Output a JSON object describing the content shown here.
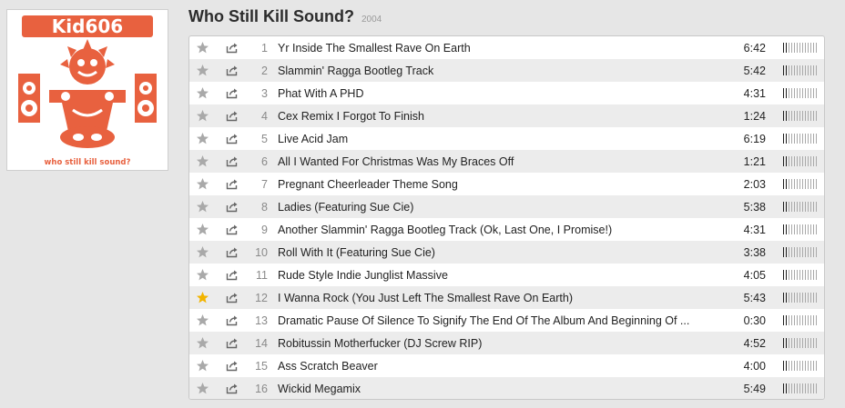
{
  "album": {
    "title": "Who Still Kill Sound?",
    "year": "2004",
    "cover": {
      "artist_text": "Kid606",
      "caption": "who still kill sound?"
    }
  },
  "colors": {
    "starred": "#f2b400",
    "unstarred": "#a9a9a9",
    "cover_accent": "#e8613f"
  },
  "icons": {
    "star": "star-icon",
    "share": "share-icon"
  },
  "tracks": [
    {
      "num": "1",
      "title": "Yr Inside The Smallest Rave On Earth",
      "duration": "6:42",
      "starred": false,
      "popularity": 0.1
    },
    {
      "num": "2",
      "title": "Slammin' Ragga Bootleg Track",
      "duration": "5:42",
      "starred": false,
      "popularity": 0.1
    },
    {
      "num": "3",
      "title": "Phat With A PHD",
      "duration": "4:31",
      "starred": false,
      "popularity": 0.1
    },
    {
      "num": "4",
      "title": "Cex Remix I Forgot To Finish",
      "duration": "1:24",
      "starred": false,
      "popularity": 0.1
    },
    {
      "num": "5",
      "title": "Live Acid Jam",
      "duration": "6:19",
      "starred": false,
      "popularity": 0.1
    },
    {
      "num": "6",
      "title": "All I Wanted For Christmas Was My Braces Off",
      "duration": "1:21",
      "starred": false,
      "popularity": 0.1
    },
    {
      "num": "7",
      "title": "Pregnant Cheerleader Theme Song",
      "duration": "2:03",
      "starred": false,
      "popularity": 0.1
    },
    {
      "num": "8",
      "title": "Ladies (Featuring Sue Cie)",
      "duration": "5:38",
      "starred": false,
      "popularity": 0.1
    },
    {
      "num": "9",
      "title": "Another Slammin' Ragga Bootleg Track (Ok, Last One, I Promise!)",
      "duration": "4:31",
      "starred": false,
      "popularity": 0.1
    },
    {
      "num": "10",
      "title": "Roll With It (Featuring Sue Cie)",
      "duration": "3:38",
      "starred": false,
      "popularity": 0.1
    },
    {
      "num": "11",
      "title": "Rude Style Indie Junglist Massive",
      "duration": "4:05",
      "starred": false,
      "popularity": 0.1
    },
    {
      "num": "12",
      "title": "I Wanna Rock (You Just Left The Smallest Rave On Earth)",
      "duration": "5:43",
      "starred": true,
      "popularity": 0.1
    },
    {
      "num": "13",
      "title": "Dramatic Pause Of Silence To Signify The End Of The Album And Beginning Of ...",
      "duration": "0:30",
      "starred": false,
      "popularity": 0.1
    },
    {
      "num": "14",
      "title": "Robitussin Motherfucker (DJ Screw RIP)",
      "duration": "4:52",
      "starred": false,
      "popularity": 0.1
    },
    {
      "num": "15",
      "title": "Ass Scratch Beaver",
      "duration": "4:00",
      "starred": false,
      "popularity": 0.1
    },
    {
      "num": "16",
      "title": "Wickid Megamix",
      "duration": "5:49",
      "starred": false,
      "popularity": 0.1
    }
  ]
}
